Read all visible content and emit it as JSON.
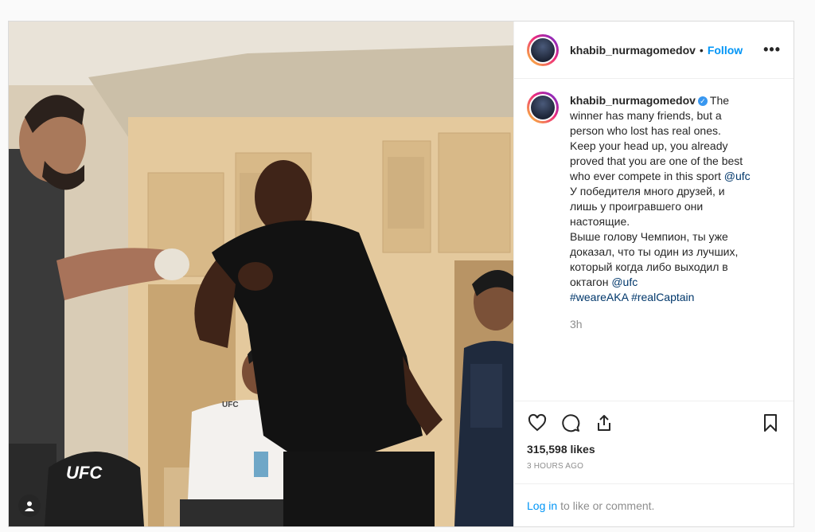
{
  "post": {
    "username": "khabib_nurmagomedov",
    "follow_label": "Follow",
    "header_separator": "•",
    "more_label": "•••",
    "caption_lines": [
      "The",
      "winner has many friends, but a",
      "person who lost has real ones.",
      "Keep your head up, you already",
      "proved that you are one of the best",
      "who ever compete in this sport",
      "@ufc",
      "У победителя много друзей, и",
      "лишь у проигравшего они",
      "настоящие.",
      "Выше голову Чемпион, ты уже",
      "доказал, что ты один из лучших,",
      "который когда либо выходил в",
      "октагон",
      "@ufc",
      "#weareAKA",
      "#realCaptain"
    ],
    "time_ago": "3h",
    "likes": "315,598 likes",
    "posted_ago": "3 HOURS AGO",
    "login_label": "Log in",
    "comment_prompt": "to like or comment.",
    "photo_chair_text": "UFC",
    "photo_shirt_text": "UFC"
  },
  "icons": {
    "like": "heart-icon",
    "comment": "comment-icon",
    "share": "share-icon",
    "save": "bookmark-icon",
    "tag": "user-tag-icon",
    "verified": "verified-badge-icon",
    "more": "more-options-icon"
  },
  "colors": {
    "follow": "#0095f6",
    "verified": "#3897f0",
    "link": "#00376b",
    "muted": "#8e8e8e",
    "border": "#dbdbdb"
  }
}
